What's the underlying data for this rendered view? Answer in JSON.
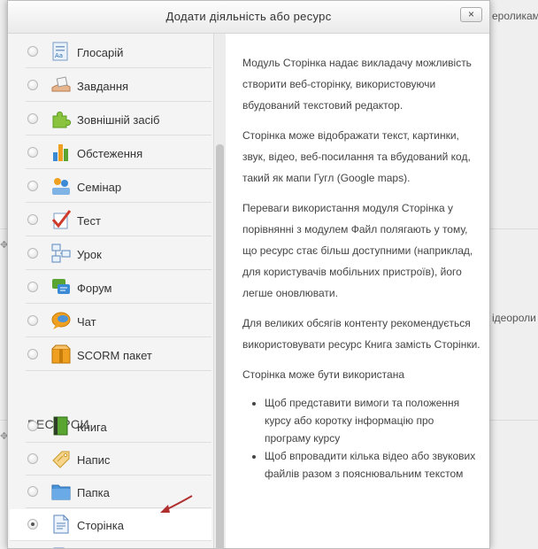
{
  "background": {
    "text_top": "ероликам",
    "text_mid": "ідеороли"
  },
  "dialog": {
    "title": "Додати діяльність або ресурс",
    "close_label": "×"
  },
  "activities": [
    {
      "label": "Глосарій",
      "icon": "glossary-icon"
    },
    {
      "label": "Завдання",
      "icon": "assignment-icon"
    },
    {
      "label": "Зовнішній засіб",
      "icon": "puzzle-icon"
    },
    {
      "label": "Обстеження",
      "icon": "survey-chart-icon"
    },
    {
      "label": "Семінар",
      "icon": "workshop-icon"
    },
    {
      "label": "Тест",
      "icon": "quiz-check-icon"
    },
    {
      "label": "Урок",
      "icon": "lesson-icon"
    },
    {
      "label": "Форум",
      "icon": "forum-icon"
    },
    {
      "label": "Чат",
      "icon": "chat-icon"
    },
    {
      "label": "SCORM пакет",
      "icon": "scorm-package-icon"
    }
  ],
  "resources_heading": "РЕСУРСИ",
  "resources": [
    {
      "label": "Книга",
      "icon": "book-icon"
    },
    {
      "label": "Напис",
      "icon": "label-tag-icon"
    },
    {
      "label": "Папка",
      "icon": "folder-icon"
    },
    {
      "label": "Сторінка",
      "icon": "page-icon",
      "selected": true
    }
  ],
  "help": {
    "p1": "Модуль Сторінка надає викладачу можливість створити веб-сторінку, використовуючи вбудований текстовий редактор.",
    "p2": "Сторінка може відображати текст, картинки, звук, відео, веб-посилання та вбудований код, такий як мапи Гугл (Google maps).",
    "p3": "Переваги використання модуля Сторінка у порівнянні з модулем Файл полягають у тому, що ресурс стає більш доступними (наприклад, для користувачів мобільних пристроїв), його легше оновлювати.",
    "p4": "Для великих обсягів контенту рекомендується використовувати ресурс Книга замість Сторінки.",
    "p5": "Сторінка може бути використана",
    "bullets": [
      "Щоб представити вимоги та положення курсу або коротку інформацію про програму курсу",
      "Щоб впровадити кілька відео або звукових файлів разом з пояснювальним текстом"
    ]
  },
  "colors": {
    "accent_green": "#5aa531",
    "accent_orange": "#f0a020",
    "accent_blue": "#3b8ad6",
    "arrow_red": "#b03030"
  }
}
